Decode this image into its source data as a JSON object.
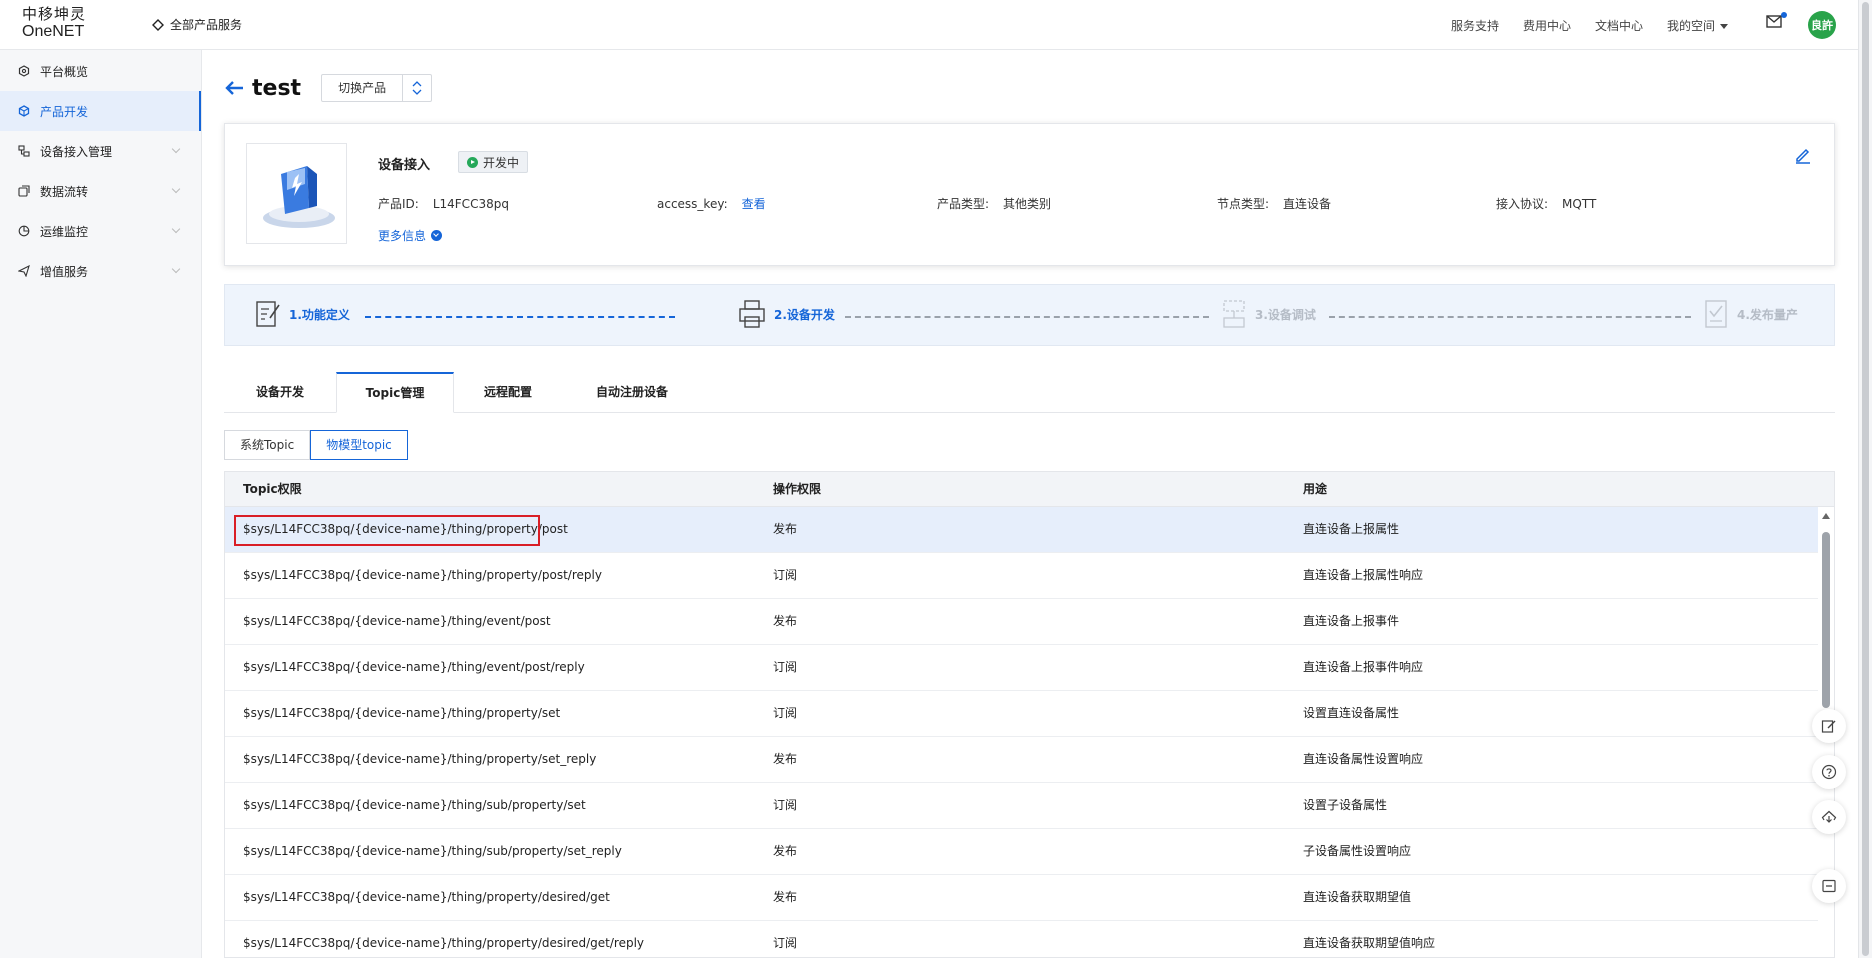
{
  "header": {
    "logo_line1": "中移坤灵",
    "logo_line2": "OneNET",
    "all_products": "全部产品服务",
    "nav": [
      "服务支持",
      "费用中心",
      "文档中心",
      "我的空间"
    ],
    "avatar_text": "良許"
  },
  "sidebar": {
    "items": [
      {
        "label": "平台概览",
        "icon": "overview-icon",
        "active": false
      },
      {
        "label": "产品开发",
        "icon": "product-dev-icon",
        "active": true
      },
      {
        "label": "设备接入管理",
        "icon": "device-access-icon",
        "active": false
      },
      {
        "label": "数据流转",
        "icon": "data-flow-icon",
        "active": false
      },
      {
        "label": "运维监控",
        "icon": "ops-monitor-icon",
        "active": false
      },
      {
        "label": "增值服务",
        "icon": "value-added-icon",
        "active": false
      }
    ]
  },
  "page": {
    "back_icon": "back-arrow-icon",
    "title": "test",
    "switch_label": "切换产品"
  },
  "product": {
    "name": "设备接入",
    "status": "开发中",
    "id_label": "产品ID:",
    "id_value": "L14FCC38pq",
    "key_label": "access_key:",
    "key_link": "查看",
    "type_label": "产品类型:",
    "type_value": "其他类别",
    "node_label": "节点类型:",
    "node_value": "直连设备",
    "protocol_label": "接入协议:",
    "protocol_value": "MQTT",
    "more_info": "更多信息"
  },
  "steps": [
    {
      "label": "1.功能定义",
      "state": "on"
    },
    {
      "label": "2.设备开发",
      "state": "on"
    },
    {
      "label": "3.设备调试",
      "state": "off"
    },
    {
      "label": "4.发布量产",
      "state": "off"
    }
  ],
  "tabs": [
    "设备开发",
    "Topic管理",
    "远程配置",
    "自动注册设备"
  ],
  "active_tab": "Topic管理",
  "segments": [
    "系统Topic",
    "物模型topic"
  ],
  "active_segment": "物模型topic",
  "table": {
    "headers": [
      "Topic权限",
      "操作权限",
      "用途"
    ],
    "rows": [
      [
        "$sys/L14FCC38pq/{device-name}/thing/property/post",
        "发布",
        "直连设备上报属性"
      ],
      [
        "$sys/L14FCC38pq/{device-name}/thing/property/post/reply",
        "订阅",
        "直连设备上报属性响应"
      ],
      [
        "$sys/L14FCC38pq/{device-name}/thing/event/post",
        "发布",
        "直连设备上报事件"
      ],
      [
        "$sys/L14FCC38pq/{device-name}/thing/event/post/reply",
        "订阅",
        "直连设备上报事件响应"
      ],
      [
        "$sys/L14FCC38pq/{device-name}/thing/property/set",
        "订阅",
        "设置直连设备属性"
      ],
      [
        "$sys/L14FCC38pq/{device-name}/thing/property/set_reply",
        "发布",
        "直连设备属性设置响应"
      ],
      [
        "$sys/L14FCC38pq/{device-name}/thing/sub/property/set",
        "订阅",
        "设置子设备属性"
      ],
      [
        "$sys/L14FCC38pq/{device-name}/thing/sub/property/set_reply",
        "发布",
        "子设备属性设置响应"
      ],
      [
        "$sys/L14FCC38pq/{device-name}/thing/property/desired/get",
        "发布",
        "直连设备获取期望值"
      ],
      [
        "$sys/L14FCC38pq/{device-name}/thing/property/desired/get/reply",
        "订阅",
        "直连设备获取期望值响应"
      ]
    ]
  },
  "float_buttons": [
    "feedback-edit-icon",
    "help-icon",
    "cloud-icon",
    "collapse-icon"
  ],
  "colors": {
    "accent": "#1565d8",
    "highlight": "#d91e26",
    "status_green": "#25a85a"
  }
}
